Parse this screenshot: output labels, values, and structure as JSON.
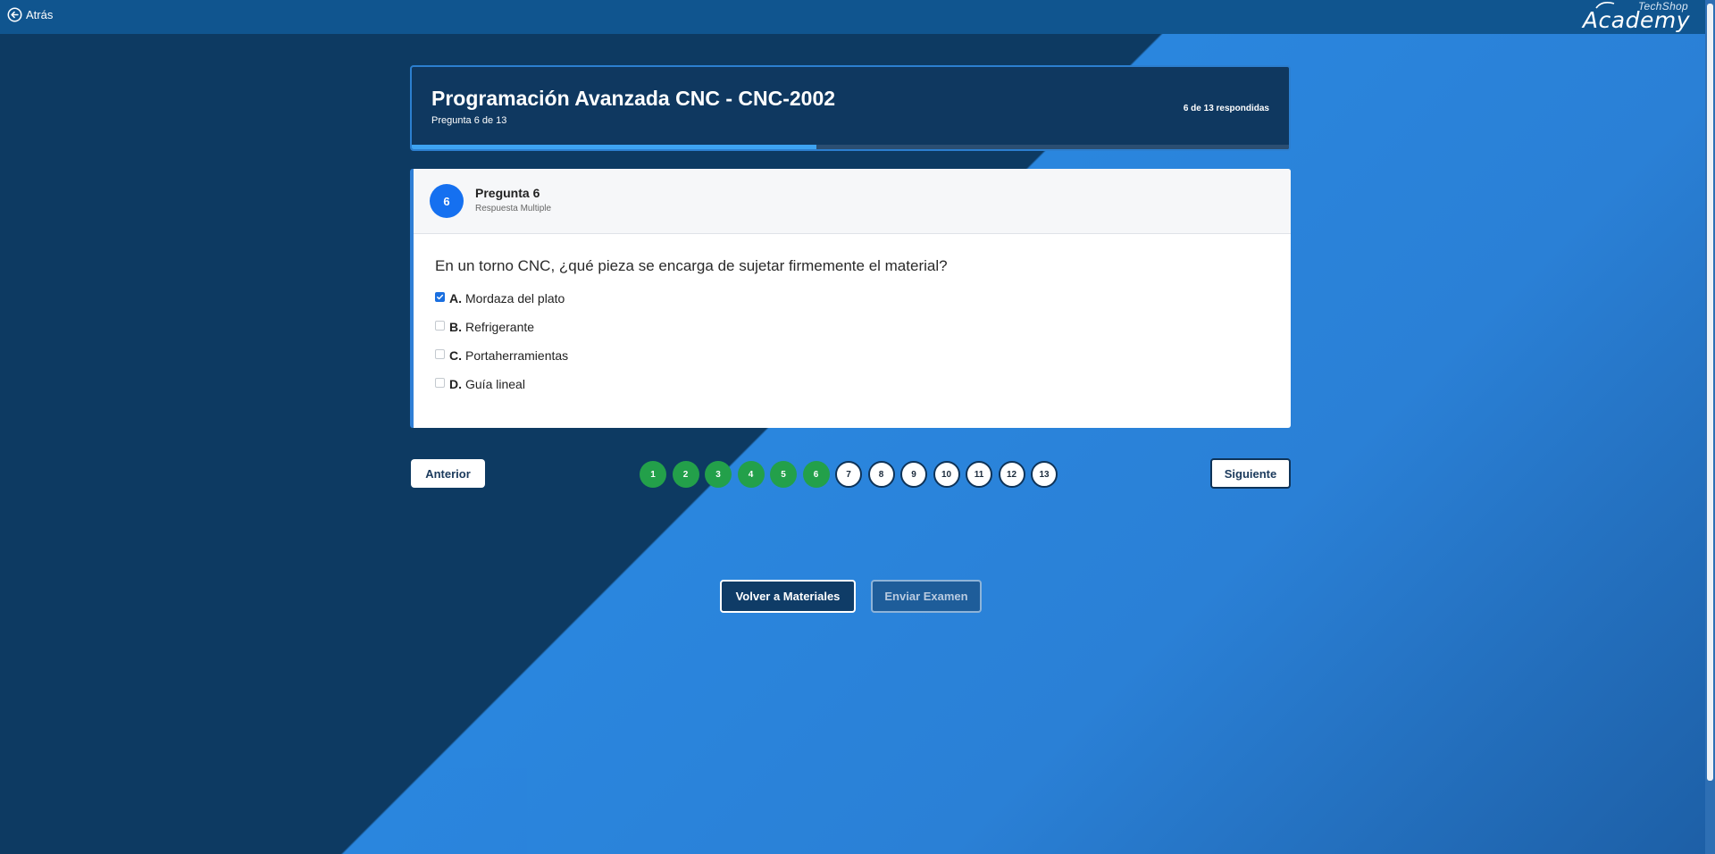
{
  "topbar": {
    "back_label": "Atrás",
    "logo_small": "TechShop",
    "logo_big": "Academy"
  },
  "header": {
    "title": "Programación Avanzada CNC - CNC-2002",
    "subtitle": "Pregunta 6 de 13",
    "answered": "6 de 13 respondidas",
    "progress_fraction": 0.4615
  },
  "question": {
    "number": "6",
    "label": "Pregunta 6",
    "type": "Respuesta Multiple",
    "text": "En un torno CNC, ¿qué pieza se encarga de sujetar firmemente el material?",
    "options": [
      {
        "key": "A.",
        "text": "Mordaza del plato",
        "checked": true
      },
      {
        "key": "B.",
        "text": "Refrigerante",
        "checked": false
      },
      {
        "key": "C.",
        "text": "Portaherramientas",
        "checked": false
      },
      {
        "key": "D.",
        "text": "Guía lineal",
        "checked": false
      }
    ]
  },
  "nav": {
    "prev_label": "Anterior",
    "next_label": "Siguiente",
    "pages": [
      {
        "label": "1",
        "answered": true
      },
      {
        "label": "2",
        "answered": true
      },
      {
        "label": "3",
        "answered": true
      },
      {
        "label": "4",
        "answered": true
      },
      {
        "label": "5",
        "answered": true
      },
      {
        "label": "6",
        "answered": true
      },
      {
        "label": "7",
        "answered": false
      },
      {
        "label": "8",
        "answered": false
      },
      {
        "label": "9",
        "answered": false
      },
      {
        "label": "10",
        "answered": false
      },
      {
        "label": "11",
        "answered": false
      },
      {
        "label": "12",
        "answered": false
      },
      {
        "label": "13",
        "answered": false
      }
    ]
  },
  "actions": {
    "back_to_materials": "Volver a Materiales",
    "submit_exam": "Enviar Examen"
  },
  "colors": {
    "answered": "#23a04a",
    "accent": "#1570f0",
    "progress": "#3ea3f2"
  }
}
